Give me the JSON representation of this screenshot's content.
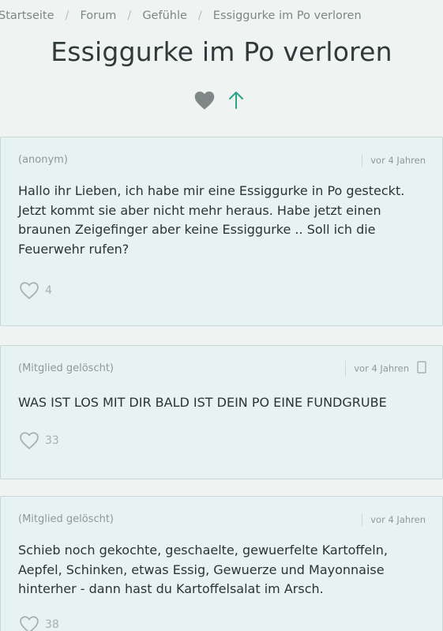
{
  "breadcrumb": {
    "items": [
      "Startseite",
      "Forum",
      "Gefühle",
      "Essiggurke im Po verloren"
    ],
    "separator": "/"
  },
  "page": {
    "title": "Essiggurke im Po verloren"
  },
  "actions": {
    "heart_icon": "heart-icon",
    "up_icon": "arrow-up-icon",
    "heart_color": "#7f8887",
    "up_color": "#2aa58c"
  },
  "posts": [
    {
      "author": "(anonym)",
      "time": "vor 4 Jahren",
      "body": "Hallo ihr Lieben, ich habe mir eine Essiggurke in Po gesteckt. Jetzt kommt sie aber nicht mehr heraus. Habe jetzt einen braunen Zeigefinger aber keine Essiggurke .. Soll ich die Feuerwehr rufen?",
      "likes": "4"
    },
    {
      "author": "(Mitglied gelöscht)",
      "time": "vor 4 Jahren",
      "body": "WAS IST LOS MIT DIR BALD IST DEIN PO EINE FUNDGRUBE",
      "likes": "33"
    },
    {
      "author": "(Mitglied gelöscht)",
      "time": "vor 4 Jahren",
      "body": "Schieb noch gekochte, geschaelte, gewuerfelte Kartoffeln, Aepfel, Schinken, etwas Essig, Gewuerze und Mayonnaise hinterher - dann hast du Kartoffelsalat im Arsch.",
      "likes": "38"
    }
  ]
}
